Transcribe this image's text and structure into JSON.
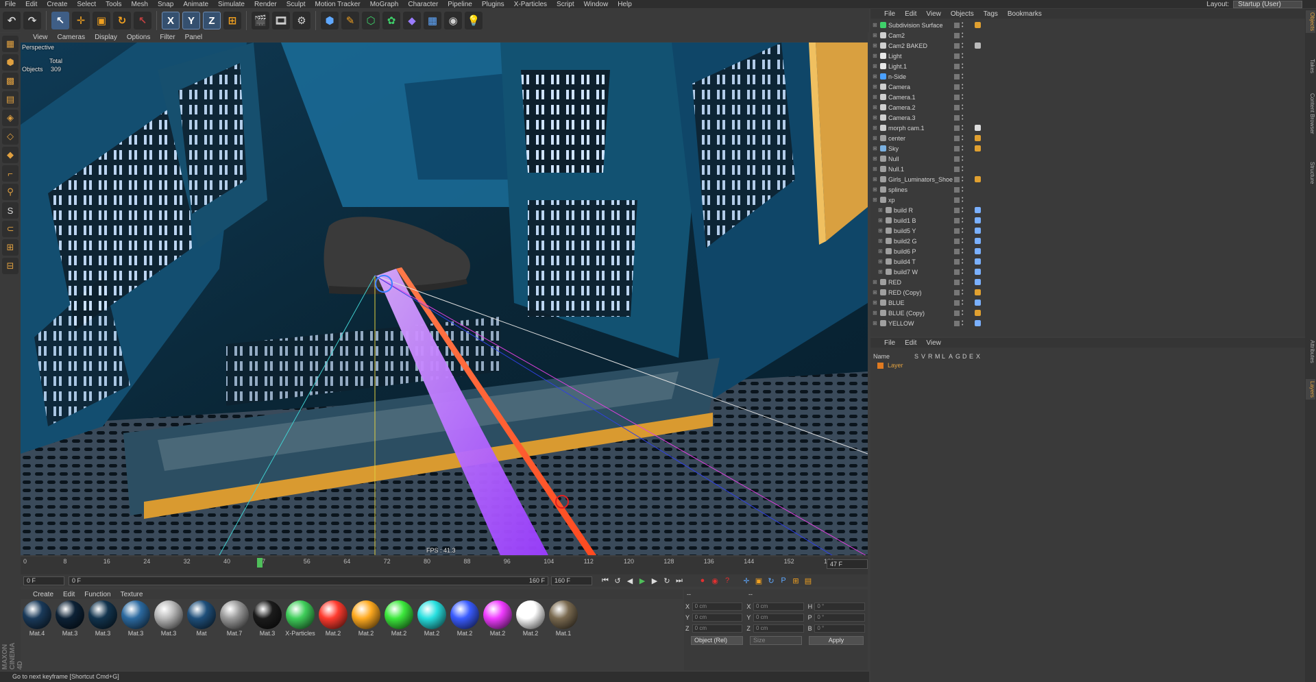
{
  "menu": [
    "File",
    "Edit",
    "Create",
    "Select",
    "Tools",
    "Mesh",
    "Snap",
    "Animate",
    "Simulate",
    "Render",
    "Sculpt",
    "Motion Tracker",
    "MoGraph",
    "Character",
    "Pipeline",
    "Plugins",
    "X-Particles",
    "Script",
    "Window",
    "Help"
  ],
  "layout": {
    "label": "Layout:",
    "value": "Startup (User)"
  },
  "viewport": {
    "menu": [
      "View",
      "Cameras",
      "Display",
      "Options",
      "Filter",
      "Panel"
    ],
    "name": "Perspective",
    "stats_total": "Total",
    "stats_objects_label": "Objects",
    "stats_objects_value": "309",
    "fps": "FPS : 41.3"
  },
  "timeline": {
    "ticks": [
      "0",
      "8",
      "16",
      "24",
      "32",
      "40",
      "47",
      "56",
      "64",
      "72",
      "80",
      "88",
      "96",
      "104",
      "112",
      "120",
      "128",
      "136",
      "144",
      "152",
      "160"
    ],
    "current_frame": "47 F",
    "current_value": 47,
    "start_field": "0 F",
    "range_start": "0 F",
    "range_end": "160 F",
    "end_field": "160 F"
  },
  "materials": {
    "menu": [
      "Create",
      "Edit",
      "Function",
      "Texture"
    ],
    "items": [
      {
        "name": "Mat.4",
        "color": "#1a3a5a"
      },
      {
        "name": "Mat.3",
        "color": "#0d2236"
      },
      {
        "name": "Mat.3",
        "color": "#12344e"
      },
      {
        "name": "Mat.3",
        "color": "#2c6aa0"
      },
      {
        "name": "Mat.3",
        "color": "#b8b8b8"
      },
      {
        "name": "Mat",
        "color": "#1f4f7a"
      },
      {
        "name": "Mat.7",
        "color": "#9a9a9a"
      },
      {
        "name": "Mat.3",
        "color": "#1b1b1b"
      },
      {
        "name": "X-Particles",
        "color": "#3fce5a"
      },
      {
        "name": "Mat.2",
        "color": "#ff3b2e"
      },
      {
        "name": "Mat.2",
        "color": "#ffaa20"
      },
      {
        "name": "Mat.2",
        "color": "#3ce83c"
      },
      {
        "name": "Mat.2",
        "color": "#28e0e0"
      },
      {
        "name": "Mat.2",
        "color": "#3a5cff"
      },
      {
        "name": "Mat.2",
        "color": "#f03cff"
      },
      {
        "name": "Mat.2",
        "color": "#ffffff"
      },
      {
        "name": "Mat.1",
        "color": "#7a6a50"
      }
    ]
  },
  "coords": {
    "header": "--",
    "x_pos": "0 cm",
    "y_pos": "0 cm",
    "z_pos": "0 cm",
    "x_size": "0 cm",
    "y_size": "0 cm",
    "z_size": "0 cm",
    "h": "0 °",
    "p": "0 °",
    "b": "0 °",
    "mode": "Object (Rel)",
    "size_mode": "Size",
    "apply": "Apply"
  },
  "status": "Go to next keyframe [Shortcut Cmd+G]",
  "brand": "MAXON CINEMA 4D",
  "objects": {
    "menu": [
      "File",
      "Edit",
      "View",
      "Objects",
      "Tags",
      "Bookmarks"
    ],
    "rows": [
      {
        "name": "Subdivision Surface",
        "indent": 0,
        "icon": "#3fd06a",
        "tag": "#e0a030"
      },
      {
        "name": "Cam2",
        "indent": 0,
        "icon": "#cfcfcf",
        "tag": ""
      },
      {
        "name": "Cam2 BAKED",
        "indent": 0,
        "icon": "#cfcfcf",
        "tag": "#bbbbbb"
      },
      {
        "name": "Light",
        "indent": 0,
        "icon": "#e8e8e8",
        "tag": ""
      },
      {
        "name": "Light.1",
        "indent": 0,
        "icon": "#e8e8e8",
        "tag": ""
      },
      {
        "name": "n-Side",
        "indent": 0,
        "icon": "#4aa0ff",
        "tag": ""
      },
      {
        "name": "Camera",
        "indent": 0,
        "icon": "#cfcfcf",
        "tag": ""
      },
      {
        "name": "Camera.1",
        "indent": 0,
        "icon": "#cfcfcf",
        "tag": ""
      },
      {
        "name": "Camera.2",
        "indent": 0,
        "icon": "#cfcfcf",
        "tag": ""
      },
      {
        "name": "Camera.3",
        "indent": 0,
        "icon": "#cfcfcf",
        "tag": ""
      },
      {
        "name": "morph cam.1",
        "indent": 0,
        "icon": "#cfcfcf",
        "tag": "#dddddd"
      },
      {
        "name": "center",
        "indent": 0,
        "icon": "#a0a0a0",
        "tag": "#e0a030"
      },
      {
        "name": "Sky",
        "indent": 0,
        "icon": "#7ab0e0",
        "tag": "#e0a030"
      },
      {
        "name": "Null",
        "indent": 0,
        "icon": "#a0a0a0",
        "tag": ""
      },
      {
        "name": "Null.1",
        "indent": 0,
        "icon": "#a0a0a0",
        "tag": ""
      },
      {
        "name": "Girls_Luminators_Shoe",
        "indent": 0,
        "icon": "#a0a0a0",
        "tag": "#e0a030"
      },
      {
        "name": "splines",
        "indent": 0,
        "icon": "#a0a0a0",
        "tag": ""
      },
      {
        "name": "xp",
        "indent": 0,
        "icon": "#a0a0a0",
        "tag": ""
      },
      {
        "name": "build R",
        "indent": 1,
        "icon": "#a0a0a0",
        "tag": "#7ab0ff"
      },
      {
        "name": "build1  B",
        "indent": 1,
        "icon": "#a0a0a0",
        "tag": "#7ab0ff"
      },
      {
        "name": "build5 Y",
        "indent": 1,
        "icon": "#a0a0a0",
        "tag": "#7ab0ff"
      },
      {
        "name": "build2 G",
        "indent": 1,
        "icon": "#a0a0a0",
        "tag": "#7ab0ff"
      },
      {
        "name": "build6 P",
        "indent": 1,
        "icon": "#a0a0a0",
        "tag": "#7ab0ff"
      },
      {
        "name": "build4 T",
        "indent": 1,
        "icon": "#a0a0a0",
        "tag": "#7ab0ff"
      },
      {
        "name": "build7 W",
        "indent": 1,
        "icon": "#a0a0a0",
        "tag": "#7ab0ff"
      },
      {
        "name": "RED",
        "indent": 0,
        "icon": "#a0a0a0",
        "tag": "#7ab0ff"
      },
      {
        "name": "RED (Copy)",
        "indent": 0,
        "icon": "#a0a0a0",
        "tag": "#e0a030"
      },
      {
        "name": "BLUE",
        "indent": 0,
        "icon": "#a0a0a0",
        "tag": "#7ab0ff"
      },
      {
        "name": "BLUE (Copy)",
        "indent": 0,
        "icon": "#a0a0a0",
        "tag": "#e0a030"
      },
      {
        "name": "YELLOW",
        "indent": 0,
        "icon": "#a0a0a0",
        "tag": "#7ab0ff"
      }
    ]
  },
  "layers": {
    "menu": [
      "File",
      "Edit",
      "View"
    ],
    "columns": [
      "Name",
      "S",
      "V",
      "R",
      "M",
      "L",
      "A",
      "G",
      "D",
      "E",
      "X"
    ],
    "row": {
      "name": "Layer",
      "color": "#e07a20"
    }
  },
  "right_tabs": [
    "Objects",
    "Takes",
    "Content Browser",
    "Structure",
    "Attributes",
    "Layers"
  ]
}
